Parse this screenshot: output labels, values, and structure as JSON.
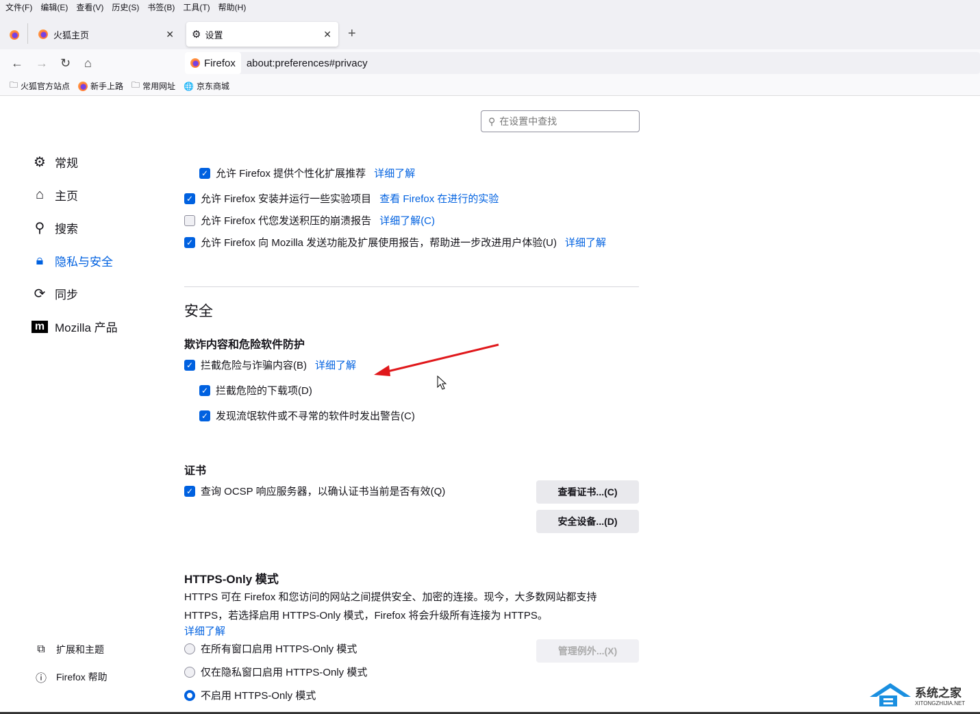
{
  "menu": [
    "文件(F)",
    "编辑(E)",
    "查看(V)",
    "历史(S)",
    "书签(B)",
    "工具(T)",
    "帮助(H)"
  ],
  "tabs": [
    {
      "label": "火狐主页"
    },
    {
      "label": "设置"
    }
  ],
  "url": {
    "identity": "Firefox",
    "address": "about:preferences#privacy"
  },
  "bookmarks": [
    "火狐官方站点",
    "新手上路",
    "常用网址",
    "京东商城"
  ],
  "search": {
    "placeholder": "在设置中查找"
  },
  "sidebar": {
    "items": [
      "常规",
      "主页",
      "搜索",
      "隐私与安全",
      "同步",
      "Mozilla 产品"
    ],
    "footer": [
      "扩展和主题",
      "Firefox 帮助"
    ]
  },
  "data_collection": [
    {
      "label": "允许 Firefox 提供个性化扩展推荐",
      "link": "详细了解",
      "checked": true
    },
    {
      "label": "允许 Firefox 安装并运行一些实验项目",
      "link": "查看 Firefox 在进行的实验",
      "checked": true
    },
    {
      "label": "允许 Firefox 代您发送积压的崩溃报告",
      "link": "详细了解(C)",
      "checked": false
    },
    {
      "label": "允许 Firefox 向 Mozilla 发送功能及扩展使用报告，帮助进一步改进用户体验(U)",
      "link": "详细了解",
      "checked": true
    }
  ],
  "security": {
    "title": "安全",
    "phishing_title": "欺诈内容和危险软件防护",
    "block": {
      "label": "拦截危险与诈骗内容(B)",
      "link": "详细了解"
    },
    "downloads": "拦截危险的下载项(D)",
    "unwanted": "发现流氓软件或不寻常的软件时发出警告(C)"
  },
  "certs": {
    "title": "证书",
    "ocsp": "查询 OCSP 响应服务器，以确认证书当前是否有效(Q)",
    "view_btn": "查看证书...(C)",
    "devices_btn": "安全设备...(D)"
  },
  "https": {
    "title": "HTTPS-Only 模式",
    "desc1": "HTTPS 可在 Firefox 和您访问的网站之间提供安全、加密的连接。现今，大多数网站都支持",
    "desc2": "HTTPS，若选择启用 HTTPS-Only 模式，Firefox 将会升级所有连接为 HTTPS。",
    "link": "详细了解",
    "options": [
      "在所有窗口启用 HTTPS-Only 模式",
      "仅在隐私窗口启用 HTTPS-Only 模式",
      "不启用 HTTPS-Only 模式"
    ],
    "selected": 2,
    "exceptions_btn": "管理例外...(X)"
  },
  "watermark": {
    "title": "系统之家",
    "sub": "XITONGZHIJIA.NET"
  },
  "colors": {
    "accent": "#0061e0",
    "arrow": "#e0181b"
  }
}
